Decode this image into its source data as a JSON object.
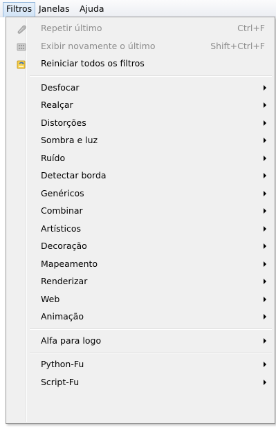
{
  "menubar": {
    "items": [
      {
        "label": "Filtros",
        "active": true
      },
      {
        "label": "Janelas",
        "active": false
      },
      {
        "label": "Ajuda",
        "active": false
      }
    ]
  },
  "dropdown": {
    "top_items": [
      {
        "label": "Repetir último",
        "shortcut": "Ctrl+F",
        "icon": "repeat-icon",
        "disabled": true
      },
      {
        "label": "Exibir novamente o último",
        "shortcut": "Shift+Ctrl+F",
        "icon": "reshow-icon",
        "disabled": true
      },
      {
        "label": "Reiniciar todos os filtros",
        "icon": "reset-filters-icon",
        "disabled": false
      }
    ],
    "groups": [
      [
        {
          "label": "Desfocar"
        },
        {
          "label": "Realçar"
        },
        {
          "label": "Distorções"
        },
        {
          "label": "Sombra e luz"
        },
        {
          "label": "Ruído"
        },
        {
          "label": "Detectar borda"
        },
        {
          "label": "Genéricos"
        },
        {
          "label": "Combinar"
        },
        {
          "label": "Artísticos"
        },
        {
          "label": "Decoração"
        },
        {
          "label": "Mapeamento"
        },
        {
          "label": "Renderizar"
        },
        {
          "label": "Web"
        },
        {
          "label": "Animação"
        }
      ],
      [
        {
          "label": "Alfa para logo"
        }
      ],
      [
        {
          "label": "Python-Fu"
        },
        {
          "label": "Script-Fu"
        }
      ]
    ]
  },
  "colors": {
    "menu_bg": "#f0f0f0",
    "disabled_text": "#8d8d8d",
    "active_menubar": "#cfe2f6"
  }
}
